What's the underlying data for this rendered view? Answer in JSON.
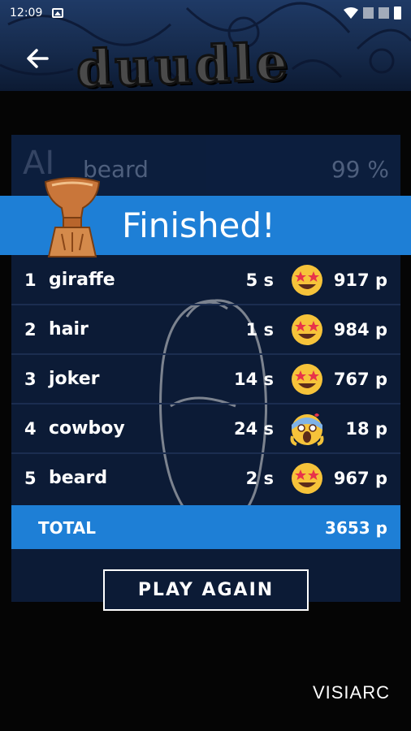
{
  "status_bar": {
    "time": "12:09"
  },
  "header": {
    "logo_text": "duudle"
  },
  "previous_result": {
    "model_label": "AI",
    "word": "beard",
    "confidence": "99 %"
  },
  "banner": {
    "title": "Finished!"
  },
  "results": [
    {
      "rank": "1",
      "word": "giraffe",
      "time": "5 s",
      "emoji": "star-struck-icon",
      "points": "917 p"
    },
    {
      "rank": "2",
      "word": "hair",
      "time": "1 s",
      "emoji": "star-struck-icon",
      "points": "984 p"
    },
    {
      "rank": "3",
      "word": "joker",
      "time": "14 s",
      "emoji": "star-struck-icon",
      "points": "767 p"
    },
    {
      "rank": "4",
      "word": "cowboy",
      "time": "24 s",
      "emoji": "screaming-face-icon",
      "points": "18 p"
    },
    {
      "rank": "5",
      "word": "beard",
      "time": "2 s",
      "emoji": "star-struck-icon",
      "points": "967 p"
    }
  ],
  "total": {
    "label": "TOTAL",
    "value": "3653 p"
  },
  "play_again_label": "PLAY AGAIN",
  "brand": "VISIARC",
  "colors": {
    "accent": "#1e7fd6",
    "card": "#0c1b36",
    "background": "#050505"
  }
}
